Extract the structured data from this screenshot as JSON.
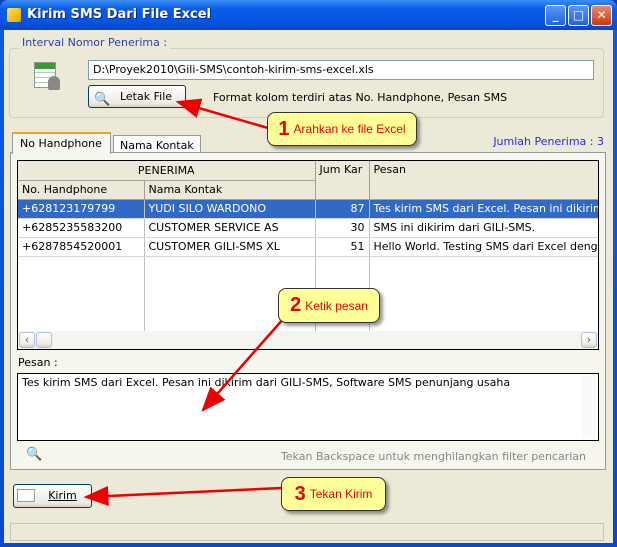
{
  "window": {
    "title": "Kirim SMS Dari File Excel",
    "icons": [
      "app-icon",
      "minimize-icon",
      "maximize-icon",
      "close-icon"
    ]
  },
  "interval": {
    "legend": "Interval Nomor Penerima :",
    "path": "D:\\Proyek2010\\Gili-SMS\\contoh-kirim-sms-excel.xls",
    "browse_label": "Letak File",
    "format_hint": "Format kolom terdiri atas No. Handphone, Pesan SMS"
  },
  "tabs": [
    {
      "label": "No Handphone",
      "active": true
    },
    {
      "label": "Nama Kontak",
      "active": false
    }
  ],
  "recipient_count": "Jumlah Penerima : 3",
  "grid": {
    "group_header": "PENERIMA",
    "col_handphone": "No. Handphone",
    "col_nama": "Nama Kontak",
    "col_jumkar": "Jum Kar",
    "col_pesan": "Pesan",
    "rows": [
      {
        "hp": "+628123179799",
        "nama": "YUDI SILO WARDONO",
        "jum": "87",
        "pesan": "Tes kirim SMS dari Excel. Pesan ini dikirim",
        "selected": true
      },
      {
        "hp": "+6285235583200",
        "nama": "CUSTOMER SERVICE AS",
        "jum": "30",
        "pesan": "SMS ini dikirim dari GILI-SMS."
      },
      {
        "hp": "+6287854520001",
        "nama": "CUSTOMER GILI-SMS XL",
        "jum": "51",
        "pesan": "Hello World. Testing SMS dari Excel deng"
      }
    ]
  },
  "message": {
    "label": "Pesan :",
    "value": "Tes kirim SMS dari Excel. Pesan ini dikirim dari GILI-SMS, Software SMS penunjang usaha"
  },
  "search_hint": "Tekan Backspace untuk menghilangkan filter pencarian",
  "send_label": "Kirim",
  "callouts": [
    {
      "num": "1",
      "text": "Arahkan ke file Excel"
    },
    {
      "num": "2",
      "text": "Ketik pesan"
    },
    {
      "num": "3",
      "text": "Tekan Kirim"
    }
  ],
  "colors": {
    "selection": "#316AC5",
    "callout_bg": "#FFFF99",
    "callout_text": "#EE0000",
    "titlebar": "#0A5CE8"
  }
}
